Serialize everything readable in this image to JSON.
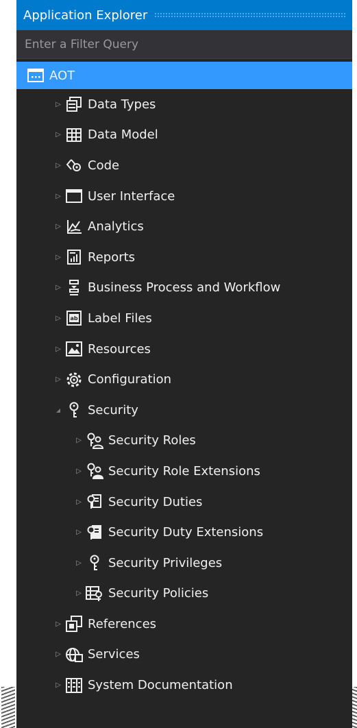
{
  "window": {
    "title": "Application Explorer"
  },
  "filter": {
    "placeholder": "Enter a Filter Query"
  },
  "tree": {
    "root": {
      "label": "AOT",
      "icon": "aot-icon",
      "selected": true
    },
    "items": [
      {
        "label": "Data Types",
        "icon": "data-types-icon",
        "expanded": false
      },
      {
        "label": "Data Model",
        "icon": "data-model-icon",
        "expanded": false
      },
      {
        "label": "Code",
        "icon": "code-icon",
        "expanded": false
      },
      {
        "label": "User Interface",
        "icon": "user-interface-icon",
        "expanded": false
      },
      {
        "label": "Analytics",
        "icon": "analytics-icon",
        "expanded": false
      },
      {
        "label": "Reports",
        "icon": "reports-icon",
        "expanded": false
      },
      {
        "label": "Business Process and Workflow",
        "icon": "workflow-icon",
        "expanded": false
      },
      {
        "label": "Label Files",
        "icon": "label-files-icon",
        "expanded": false
      },
      {
        "label": "Resources",
        "icon": "resources-icon",
        "expanded": false
      },
      {
        "label": "Configuration",
        "icon": "configuration-icon",
        "expanded": false
      },
      {
        "label": "Security",
        "icon": "security-icon",
        "expanded": true
      },
      {
        "label": "References",
        "icon": "references-icon",
        "expanded": false
      },
      {
        "label": "Services",
        "icon": "services-icon",
        "expanded": false
      },
      {
        "label": "System Documentation",
        "icon": "system-documentation-icon",
        "expanded": false
      }
    ],
    "security_children": [
      {
        "label": "Security Roles",
        "icon": "security-roles-icon"
      },
      {
        "label": "Security Role Extensions",
        "icon": "security-role-extensions-icon"
      },
      {
        "label": "Security Duties",
        "icon": "security-duties-icon"
      },
      {
        "label": "Security Duty Extensions",
        "icon": "security-duty-extensions-icon"
      },
      {
        "label": "Security Privileges",
        "icon": "security-privileges-icon"
      },
      {
        "label": "Security Policies",
        "icon": "security-policies-icon"
      }
    ]
  },
  "colors": {
    "title_bar": "#007acc",
    "selection": "#3399ff",
    "panel_bg": "#252526",
    "text": "#f1f1f1"
  }
}
